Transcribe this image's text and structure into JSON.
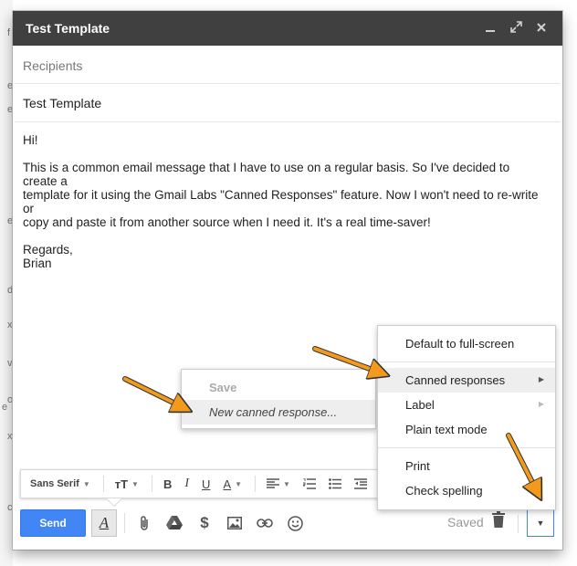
{
  "background_fragments": [
    "f",
    "e",
    "e",
    "e",
    "d",
    "x",
    "v",
    "o",
    "e",
    "x",
    "c"
  ],
  "window": {
    "title": "Test Template",
    "controls": {
      "minimize": "minimize-icon",
      "expand": "expand-icon",
      "close": "close-icon"
    }
  },
  "recipients": {
    "placeholder": "Recipients"
  },
  "subject": {
    "value": "Test Template"
  },
  "message": {
    "greeting": "Hi!",
    "paragraph_line1": "This is a common email message that I have to use on a regular basis. So I've decided to create a",
    "paragraph_line2": "template for it using the Gmail Labs \"Canned Responses\" feature. Now I won't need to re-write or",
    "paragraph_line3": "copy and paste it from another source when I need it. It's a real time-saver!",
    "closing": "Regards,",
    "signature": "Brian"
  },
  "format_toolbar": {
    "font": "Sans Serif",
    "icons": [
      "text-size-icon",
      "bold-icon",
      "italic-icon",
      "underline-icon",
      "text-color-icon",
      "align-icon",
      "numbered-list-icon",
      "bulleted-list-icon",
      "indent-less-icon",
      "indent-more-icon"
    ]
  },
  "bottom_bar": {
    "send_label": "Send",
    "saved_label": "Saved",
    "icons": [
      "formatting-icon",
      "attach-icon",
      "drive-icon",
      "money-icon",
      "photo-icon",
      "link-icon",
      "emoji-icon",
      "trash-icon",
      "more-options-icon"
    ]
  },
  "canned_submenu": {
    "items": [
      {
        "label": "Save",
        "state": "disabled"
      },
      {
        "label": "New canned response...",
        "state": "hover"
      }
    ]
  },
  "more_menu": {
    "items": [
      {
        "label": "Default to full-screen"
      },
      {
        "label": "Canned responses",
        "submenu": true,
        "state": "highlighted"
      },
      {
        "label": "Label",
        "submenu": true
      },
      {
        "label": "Plain text mode"
      },
      {
        "label": "Print"
      },
      {
        "label": "Check spelling"
      }
    ]
  },
  "colors": {
    "title_bar": "#404040",
    "send_button": "#4285f4",
    "annotation_arrow": "#f39a1d",
    "menu_highlight": "#eeeeee"
  }
}
